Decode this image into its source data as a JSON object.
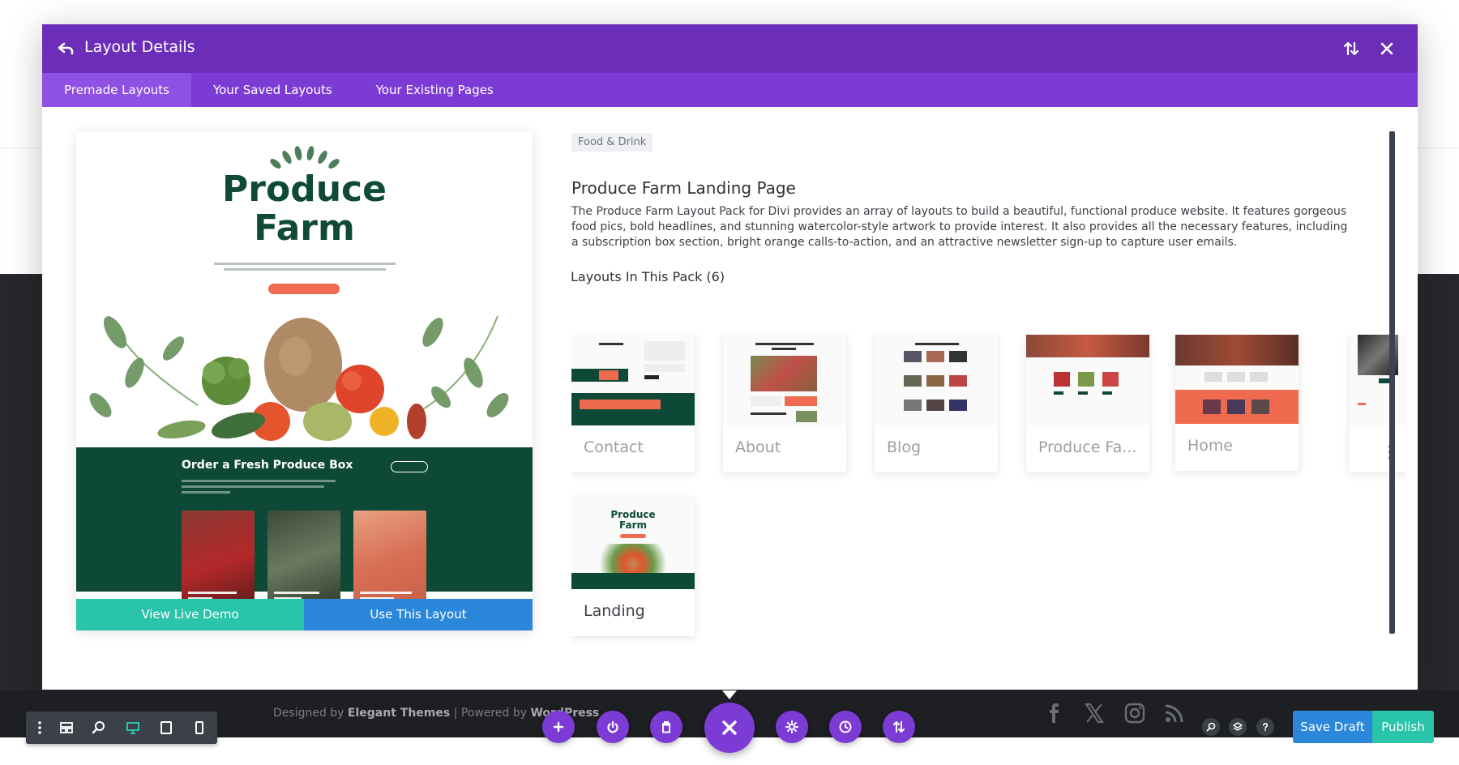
{
  "modal": {
    "title": "Layout Details",
    "tabs": [
      {
        "label": "Premade Layouts",
        "active": true
      },
      {
        "label": "Your Saved Layouts",
        "active": false
      },
      {
        "label": "Your Existing Pages",
        "active": false
      }
    ]
  },
  "preview": {
    "title_line1": "Produce",
    "title_line2": "Farm",
    "section_title": "Order a Fresh Produce Box",
    "view_demo_label": "View Live Demo",
    "use_layout_label": "Use This Layout"
  },
  "details": {
    "category": "Food & Drink",
    "name": "Produce Farm Landing Page",
    "description": "The Produce Farm Layout Pack for Divi provides an array of layouts to build a beautiful, functional produce website. It features gorgeous food pics, bold headlines, and stunning watercolor-style artwork to provide interest. It also provides all the necessary features, including a subscription box section, bright orange calls-to-action, and an attractive newsletter sign-up to capture user emails.",
    "pack_heading": "Layouts In This Pack (6)",
    "layouts": [
      {
        "label": "Contact"
      },
      {
        "label": "About"
      },
      {
        "label": "Blog"
      },
      {
        "label": "Produce Fa..."
      },
      {
        "label": "Home"
      },
      {
        "label": "Landing"
      }
    ]
  },
  "footer": {
    "designed_by": "Designed by",
    "brand": "Elegant Themes",
    "separator": "|",
    "powered_by": "Powered by",
    "platform": "WordPress"
  },
  "actions": {
    "save_draft": "Save Draft",
    "publish": "Publish"
  },
  "colors": {
    "header_purple": "#6c2eb9",
    "tab_purple": "#7d3bd6",
    "demo_teal": "#29c4a9",
    "use_blue": "#2b87da",
    "farm_green": "#0e4938"
  }
}
